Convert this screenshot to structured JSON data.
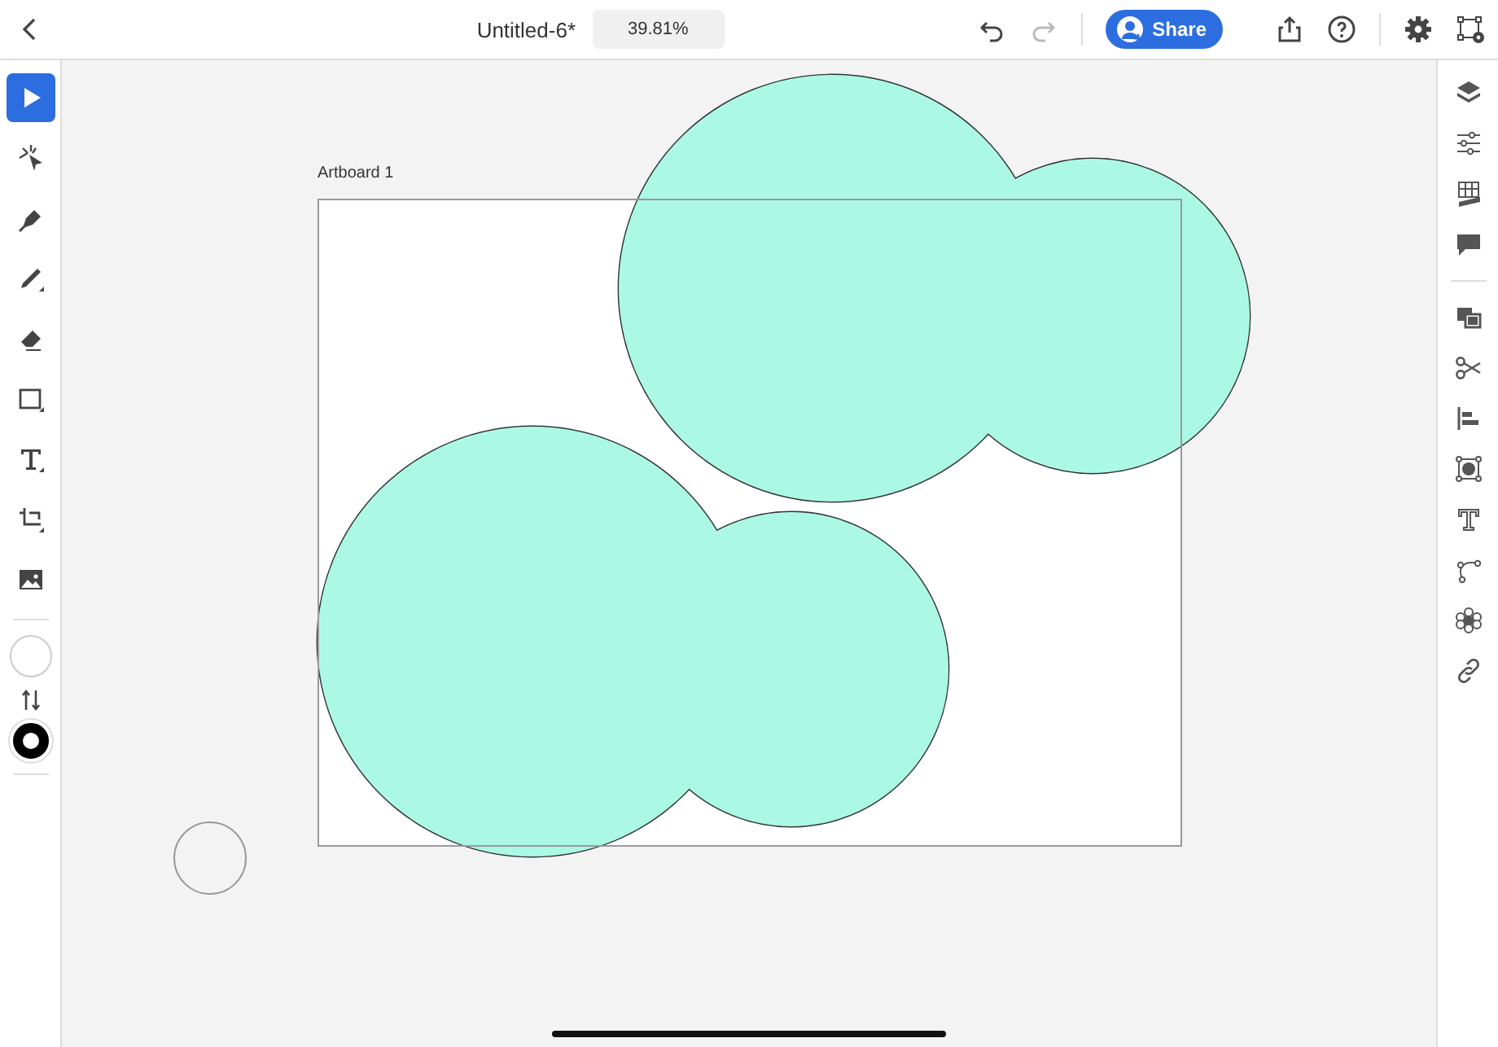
{
  "document": {
    "title": "Untitled-6*",
    "zoom": "39.81%"
  },
  "share_button": {
    "label": "Share"
  },
  "tools": [
    {
      "selected": true
    },
    {
      "selected": false
    },
    {
      "selected": false
    },
    {
      "selected": false
    },
    {
      "selected": false
    },
    {
      "selected": false
    },
    {
      "selected": false
    },
    {
      "selected": false
    },
    {
      "selected": false
    }
  ],
  "artboard": {
    "label": "Artboard 1"
  }
}
